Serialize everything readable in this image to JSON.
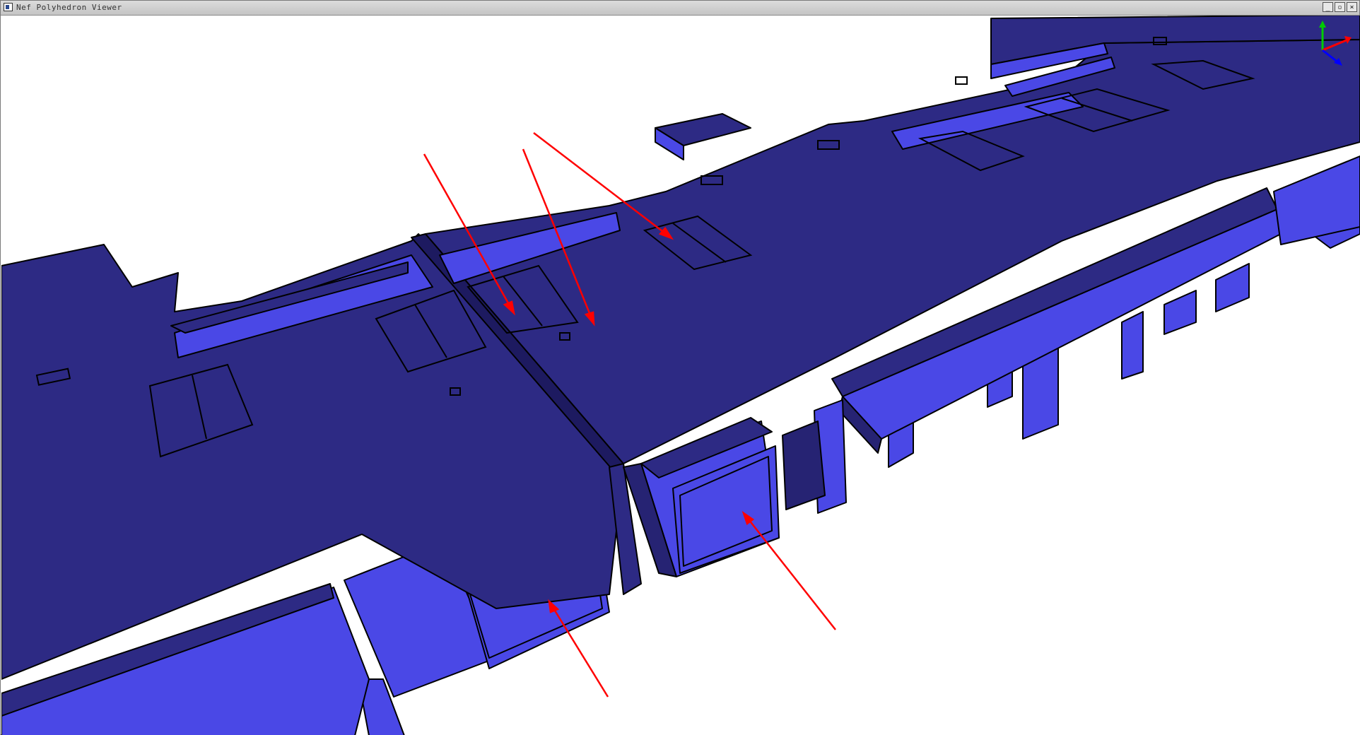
{
  "window": {
    "title": "Nef Polyhedron Viewer",
    "controls": {
      "minimize": "_",
      "restore": "▫",
      "close": "×"
    }
  },
  "colors": {
    "top_face": "#2d2a84",
    "side_face": "#4a48e6",
    "dark_face": "#262373",
    "edge": "#000000",
    "annotation": "#ff0000",
    "axis_x": "#ff0000",
    "axis_y": "#00cc00",
    "axis_z": "#0000ff"
  },
  "icons": [
    "app-icon",
    "minimize-icon",
    "restore-icon",
    "close-icon",
    "axis-gizmo-icon"
  ]
}
